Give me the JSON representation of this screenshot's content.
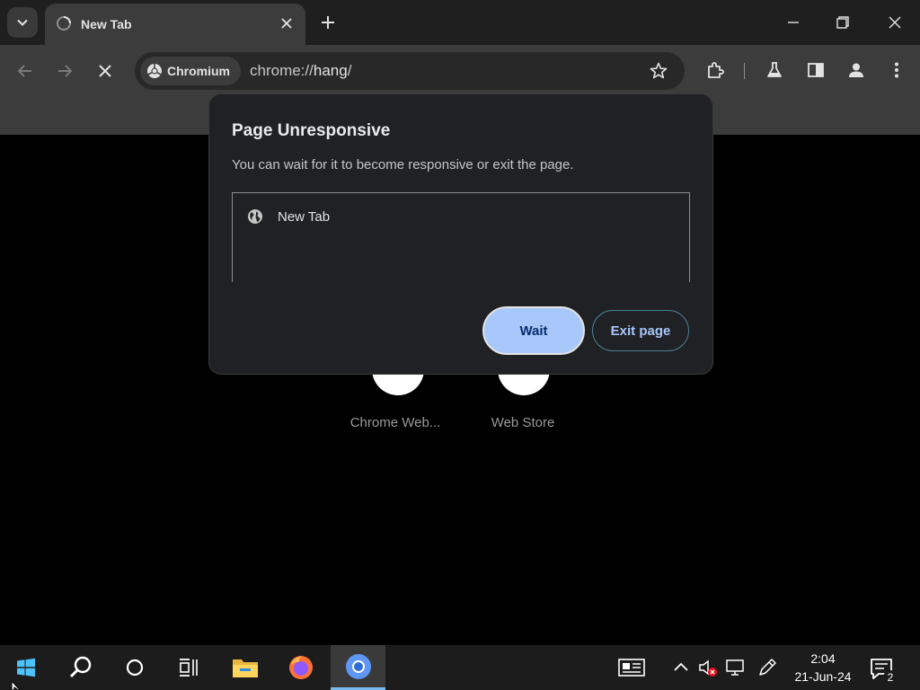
{
  "browser": {
    "tab": {
      "title": "New Tab"
    },
    "omnibox": {
      "chip_label": "Chromium",
      "url_scheme": "chrome://",
      "url_host": "hang",
      "url_suffix": "/"
    }
  },
  "newtab_page": {
    "shortcuts": [
      {
        "label": "Chrome Web..."
      },
      {
        "label": "Web Store"
      }
    ]
  },
  "dialog": {
    "title": "Page Unresponsive",
    "message": "You can wait for it to become responsive or exit the page.",
    "pages": [
      {
        "label": "New Tab"
      }
    ],
    "wait_label": "Wait",
    "exit_label": "Exit page"
  },
  "taskbar": {
    "time": "2:04",
    "date": "21-Jun-24",
    "notification_count": "2"
  },
  "colors": {
    "accent": "#a8c7fa",
    "dialog_bg": "#202124",
    "toolbar_bg": "#3c3c3c",
    "taskbar_active": "#76b9ed"
  }
}
